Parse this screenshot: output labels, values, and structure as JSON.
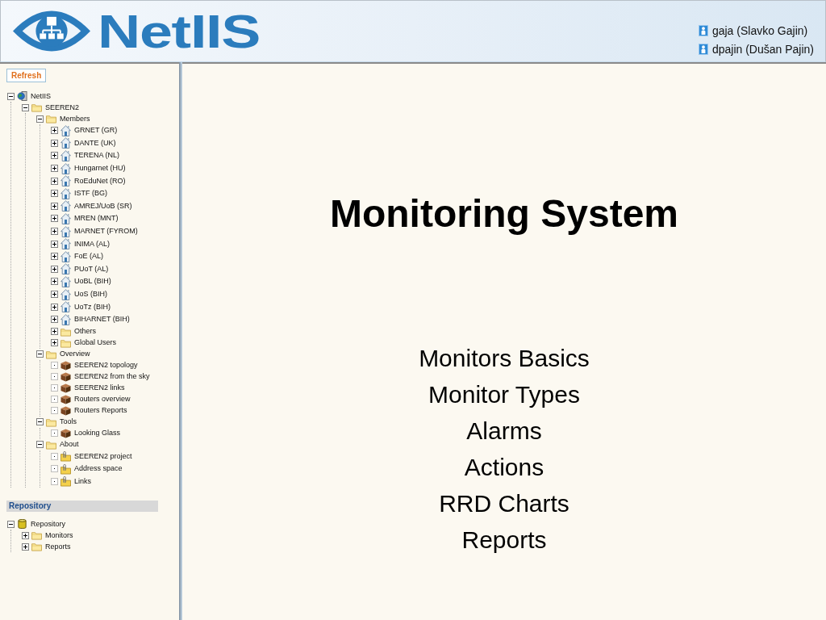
{
  "header": {
    "logo": "NetIIS",
    "users": [
      "gaja (Slavko Gajin)",
      "dpajin (Dušan Pajin)"
    ]
  },
  "sidebar": {
    "refresh_button": "Refresh",
    "tree": [
      {
        "label": "NetIIS",
        "kind": "root",
        "expandable": true,
        "expanded": true,
        "children": [
          {
            "label": "SEEREN2",
            "kind": "folder",
            "expandable": true,
            "expanded": true,
            "children": [
              {
                "label": "Members",
                "kind": "folder",
                "expandable": true,
                "expanded": true,
                "children": [
                  {
                    "label": "GRNET (GR)",
                    "kind": "site",
                    "expandable": true,
                    "expanded": false
                  },
                  {
                    "label": "DANTE (UK)",
                    "kind": "site",
                    "expandable": true,
                    "expanded": false
                  },
                  {
                    "label": "TERENA (NL)",
                    "kind": "site",
                    "expandable": true,
                    "expanded": false
                  },
                  {
                    "label": "Hungarnet (HU)",
                    "kind": "site",
                    "expandable": true,
                    "expanded": false
                  },
                  {
                    "label": "RoEduNet (RO)",
                    "kind": "site",
                    "expandable": true,
                    "expanded": false
                  },
                  {
                    "label": "ISTF (BG)",
                    "kind": "site",
                    "expandable": true,
                    "expanded": false
                  },
                  {
                    "label": "AMREJ/UoB (SR)",
                    "kind": "site",
                    "expandable": true,
                    "expanded": false
                  },
                  {
                    "label": "MREN (MNT)",
                    "kind": "site",
                    "expandable": true,
                    "expanded": false
                  },
                  {
                    "label": "MARNET (FYROM)",
                    "kind": "site",
                    "expandable": true,
                    "expanded": false
                  },
                  {
                    "label": "INIMA (AL)",
                    "kind": "site",
                    "expandable": true,
                    "expanded": false
                  },
                  {
                    "label": "FoE (AL)",
                    "kind": "site",
                    "expandable": true,
                    "expanded": false
                  },
                  {
                    "label": "PUoT (AL)",
                    "kind": "site",
                    "expandable": true,
                    "expanded": false
                  },
                  {
                    "label": "UoBL (BIH)",
                    "kind": "site",
                    "expandable": true,
                    "expanded": false
                  },
                  {
                    "label": "UoS (BIH)",
                    "kind": "site",
                    "expandable": true,
                    "expanded": false
                  },
                  {
                    "label": "UoTz (BIH)",
                    "kind": "site",
                    "expandable": true,
                    "expanded": false
                  },
                  {
                    "label": "BIHARNET (BIH)",
                    "kind": "site",
                    "expandable": true,
                    "expanded": false
                  },
                  {
                    "label": "Others",
                    "kind": "folder",
                    "expandable": true,
                    "expanded": false
                  },
                  {
                    "label": "Global Users",
                    "kind": "folder",
                    "expandable": true,
                    "expanded": false
                  }
                ]
              },
              {
                "label": "Overview",
                "kind": "folder",
                "expandable": true,
                "expanded": true,
                "children": [
                  {
                    "label": "SEEREN2 topology",
                    "kind": "view",
                    "expandable": false,
                    "expanded": false
                  },
                  {
                    "label": "SEEREN2 from the sky",
                    "kind": "view",
                    "expandable": false,
                    "expanded": false
                  },
                  {
                    "label": "SEEREN2 links",
                    "kind": "view",
                    "expandable": false,
                    "expanded": false
                  },
                  {
                    "label": "Routers overview",
                    "kind": "view",
                    "expandable": false,
                    "expanded": false
                  },
                  {
                    "label": "Routers Reports",
                    "kind": "view",
                    "expandable": false,
                    "expanded": false
                  }
                ]
              },
              {
                "label": "Tools",
                "kind": "folder",
                "expandable": true,
                "expanded": true,
                "children": [
                  {
                    "label": "Looking Glass",
                    "kind": "view",
                    "expandable": false,
                    "expanded": false
                  }
                ]
              },
              {
                "label": "About",
                "kind": "folder",
                "expandable": true,
                "expanded": true,
                "children": [
                  {
                    "label": "SEEREN2 project",
                    "kind": "page",
                    "expandable": false,
                    "expanded": false
                  },
                  {
                    "label": "Address space",
                    "kind": "page",
                    "expandable": false,
                    "expanded": false
                  },
                  {
                    "label": "Links",
                    "kind": "page",
                    "expandable": false,
                    "expanded": false
                  }
                ]
              }
            ]
          }
        ]
      }
    ],
    "repository": {
      "title": "Repository",
      "tree": [
        {
          "label": "Repository",
          "kind": "store",
          "expandable": true,
          "expanded": true,
          "children": [
            {
              "label": "Monitors",
              "kind": "folder",
              "expandable": true,
              "expanded": false
            },
            {
              "label": "Reports",
              "kind": "folder",
              "expandable": true,
              "expanded": false
            }
          ]
        }
      ]
    }
  },
  "main": {
    "title": "Monitoring System",
    "topics": [
      "Monitors Basics",
      "Monitor Types",
      "Alarms",
      "Actions",
      "RRD Charts",
      "Reports"
    ]
  }
}
